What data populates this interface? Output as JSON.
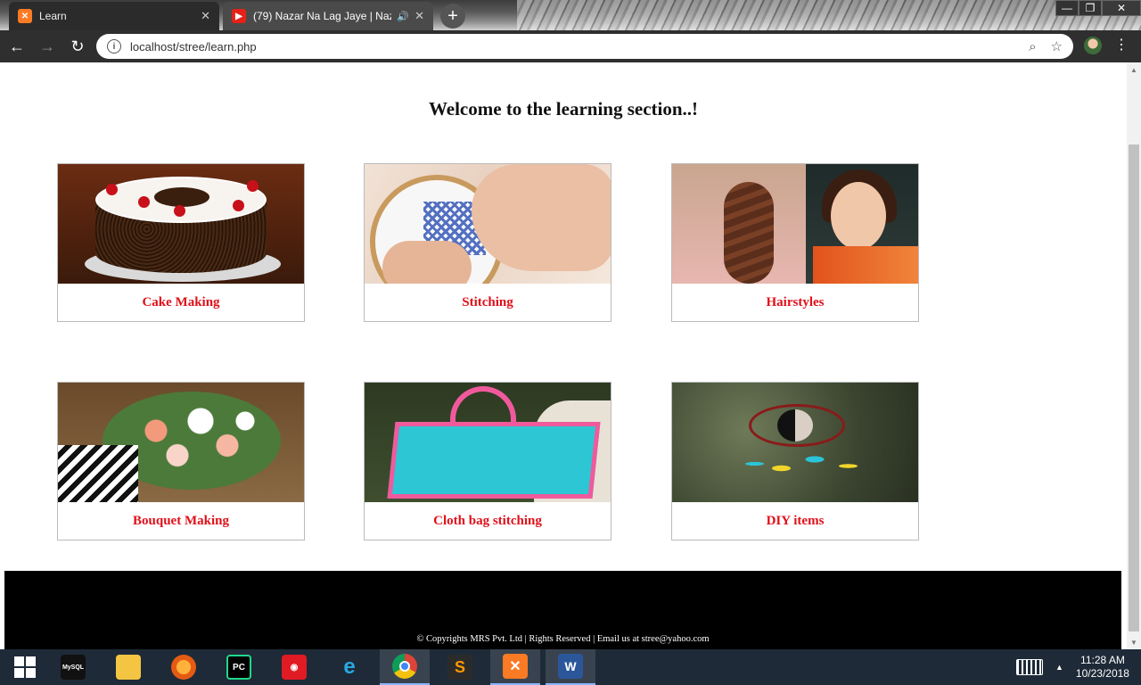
{
  "browser": {
    "tabs": [
      {
        "title": "Learn",
        "active": false
      },
      {
        "title": "(79) Nazar Na Lag Jaye | Naz",
        "active": true
      }
    ],
    "url": "localhost/stree/learn.php"
  },
  "page": {
    "title": "Welcome to the learning section..!",
    "cards": [
      {
        "label": "Cake Making"
      },
      {
        "label": "Stitching"
      },
      {
        "label": "Hairstyles"
      },
      {
        "label": "Bouquet Making"
      },
      {
        "label": "Cloth bag stitching"
      },
      {
        "label": "DIY items"
      }
    ],
    "footer": "© Copyrights MRS Pvt. Ltd | Rights Reserved | Email us at stree@yahoo.com"
  },
  "colors": {
    "card_label": "#e0101a",
    "footer_bg": "#000000"
  },
  "taskbar": {
    "apps": [
      "start",
      "mysql-console",
      "file-explorer",
      "firefox",
      "pycharm",
      "smartlinks",
      "internet-explorer",
      "chrome",
      "sublime-text",
      "xampp",
      "word"
    ],
    "time": "11:28 AM",
    "date": "10/23/2018"
  }
}
